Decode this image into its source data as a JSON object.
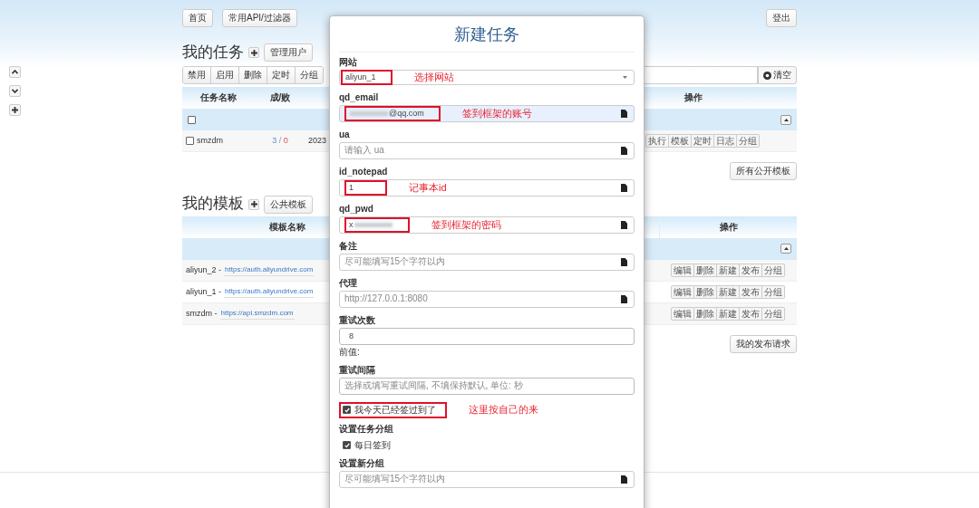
{
  "nav": {
    "left": [
      "首页",
      "常用API/过滤器"
    ],
    "right": "登出"
  },
  "side_buttons": [
    {
      "kind": "up"
    },
    {
      "kind": "down"
    },
    {
      "kind": "plus"
    }
  ],
  "tasks": {
    "title": "我的任务",
    "buttons": [
      "管理用户"
    ],
    "toolbar": [
      "禁用",
      "启用",
      "删除",
      "定时",
      "分组"
    ],
    "clear": "清空",
    "columns": [
      "任务名称",
      "成/败",
      "操作"
    ],
    "select_all": {
      "checked": false
    },
    "rows": [
      {
        "checked": false,
        "name": "smzdm",
        "success": "3",
        "separator": "/",
        "fail": "0",
        "date": "2023",
        "actions": [
          "执行",
          "模板",
          "定时",
          "日志",
          "分组"
        ]
      }
    ],
    "footer_button": "所有公开模板"
  },
  "templates": {
    "title": "我的模板",
    "buttons": [
      "公共模板"
    ],
    "columns": [
      "模板名称",
      "操作"
    ],
    "rows": [
      {
        "name": "aliyun_2 -",
        "url": "https://auth.aliyundrive.com",
        "actions": [
          "编辑",
          "删除",
          "新建",
          "发布",
          "分组"
        ]
      },
      {
        "name": "aliyun_1 -",
        "url": "https://auth.aliyundrive.com",
        "actions": [
          "编辑",
          "删除",
          "新建",
          "发布",
          "分组"
        ]
      },
      {
        "name": "smzdm -",
        "url": "https://api.smzdm.com",
        "actions": [
          "编辑",
          "删除",
          "新建",
          "发布",
          "分组"
        ]
      }
    ],
    "footer_button": "我的发布请求"
  },
  "dialog": {
    "title": "新建任务",
    "items": [
      {
        "kind": "select",
        "label": "网站",
        "value_parts": [
          {
            "kind": "text",
            "text": "aliyun_1"
          }
        ],
        "note": "选择网站"
      },
      {
        "kind": "field",
        "label": "qd_email",
        "value_parts": [
          {
            "kind": "blur"
          },
          {
            "kind": "text",
            "text": "@qq.com"
          }
        ],
        "autofilled": true,
        "note": "签到框架的账号"
      },
      {
        "kind": "field",
        "label": "ua",
        "placeholder": "请输入 ua"
      },
      {
        "kind": "field",
        "label": "id_notepad",
        "value_parts": [
          {
            "kind": "text",
            "text": "1"
          }
        ],
        "note": "记事本id"
      },
      {
        "kind": "field",
        "label": "qd_pwd",
        "value_parts": [
          {
            "kind": "text",
            "text": "x"
          },
          {
            "kind": "blur"
          }
        ],
        "note": "签到框架的密码"
      },
      {
        "kind": "field",
        "label": "备注",
        "placeholder": "尽可能填写15个字符以内"
      },
      {
        "kind": "field",
        "label": "代理",
        "placeholder": "http://127.0.0.1:8080"
      },
      {
        "kind": "plain",
        "label": "重试次数",
        "value_parts": [
          {
            "kind": "text",
            "text": "8"
          }
        ],
        "help": "前值:"
      },
      {
        "kind": "plain",
        "label": "重试间隔",
        "placeholder": "选择或填写重试间隔, 不填保持默认, 单位: 秒"
      },
      {
        "kind": "checkbox",
        "label": "我今天已经签过到了",
        "checked": true,
        "note": "这里按自己的来"
      },
      {
        "kind": "heading",
        "label": "设置任务分组"
      },
      {
        "kind": "checkbox",
        "label": "每日签到",
        "checked": true
      },
      {
        "kind": "field",
        "label": "设置新分组",
        "placeholder": "尽可能填写15个字符以内"
      }
    ]
  }
}
